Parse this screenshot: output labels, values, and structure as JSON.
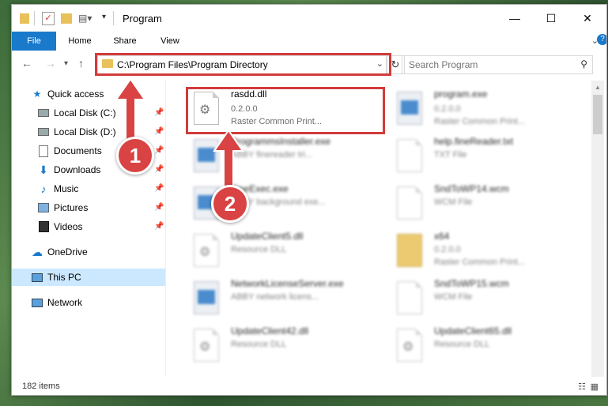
{
  "window": {
    "title": "Program",
    "controls": {
      "minimize": "—",
      "maximize": "☐",
      "close": "✕"
    }
  },
  "ribbon": {
    "tabs": [
      {
        "label": "File"
      },
      {
        "label": "Home"
      },
      {
        "label": "Share"
      },
      {
        "label": "View"
      }
    ]
  },
  "address": {
    "path": "C:\\Program Files\\Program Directory"
  },
  "search": {
    "placeholder": "Search Program"
  },
  "sidebar": {
    "items": [
      {
        "label": "Quick access"
      },
      {
        "label": "Local Disk (C:)"
      },
      {
        "label": "Local Disk (D:)"
      },
      {
        "label": "Documents"
      },
      {
        "label": "Downloads"
      },
      {
        "label": "Music"
      },
      {
        "label": "Pictures"
      },
      {
        "label": "Videos"
      },
      {
        "label": "OneDrive"
      },
      {
        "label": "This PC"
      },
      {
        "label": "Network"
      }
    ]
  },
  "files": [
    {
      "name": "rasdd.dll",
      "line1": "0.2.0.0",
      "line2": "Raster Common Print..."
    },
    {
      "name": "program.exe",
      "line1": "0.2.0.0",
      "line2": "Raster Common Print..."
    },
    {
      "name": "ProgrammsInstaller.exe",
      "line1": "ABBY finereader tri...",
      "line2": ""
    },
    {
      "name": "help.fineReader.txt",
      "line1": "TXT File",
      "line2": ""
    },
    {
      "name": "FineExec.exe",
      "line1": "ABBY background exe...",
      "line2": ""
    },
    {
      "name": "SndToWP14.wcm",
      "line1": "WCM File",
      "line2": ""
    },
    {
      "name": "UpdateClient5.dll",
      "line1": "Resource DLL",
      "line2": ""
    },
    {
      "name": "x64",
      "line1": "0.2.0.0",
      "line2": "Raster Common Print..."
    },
    {
      "name": "NetworkLicenseServer.exe",
      "line1": "ABBY network licens...",
      "line2": ""
    },
    {
      "name": "SndToWP15.wcm",
      "line1": "WCM File",
      "line2": ""
    },
    {
      "name": "UpdateClient42.dll",
      "line1": "Resource DLL",
      "line2": ""
    },
    {
      "name": "UpdateClient65.dll",
      "line1": "Resource DLL",
      "line2": ""
    }
  ],
  "status": {
    "item_count": "182 items"
  },
  "callouts": {
    "one": "1",
    "two": "2"
  },
  "colors": {
    "accent": "#1979ca",
    "highlight_red": "#d23b3b",
    "selection": "#cce8ff"
  }
}
